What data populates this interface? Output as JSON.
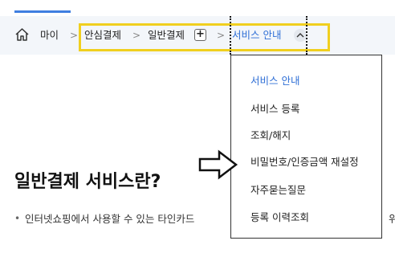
{
  "breadcrumb": {
    "home_label": "마이",
    "items": [
      {
        "label": "안심결제"
      },
      {
        "label": "일반결제"
      },
      {
        "label": "서비스 안내"
      }
    ],
    "separator": ">",
    "plus_label": "+"
  },
  "dropdown": {
    "items": [
      {
        "label": "서비스 안내",
        "active": true
      },
      {
        "label": "서비스 등록"
      },
      {
        "label": "조회/해지"
      },
      {
        "label": "비밀번호/인증금액 재설정"
      },
      {
        "label": "자주묻는질문"
      },
      {
        "label": "등록 이력조회"
      }
    ]
  },
  "page": {
    "title": "일반결제 서비스란?",
    "bullet": "•",
    "description": "인터넷쇼핑에서 사용할 수 있는 타인카드",
    "description_tail": "위"
  },
  "colors": {
    "accent": "#2f6fd6",
    "highlight": "#f0cf1f",
    "breadcrumb_bg": "#f3f6fa"
  },
  "icons": {
    "home": "home-icon",
    "arrow": "arrow-right-outline-icon",
    "toggle": "chevron-up-icon"
  }
}
